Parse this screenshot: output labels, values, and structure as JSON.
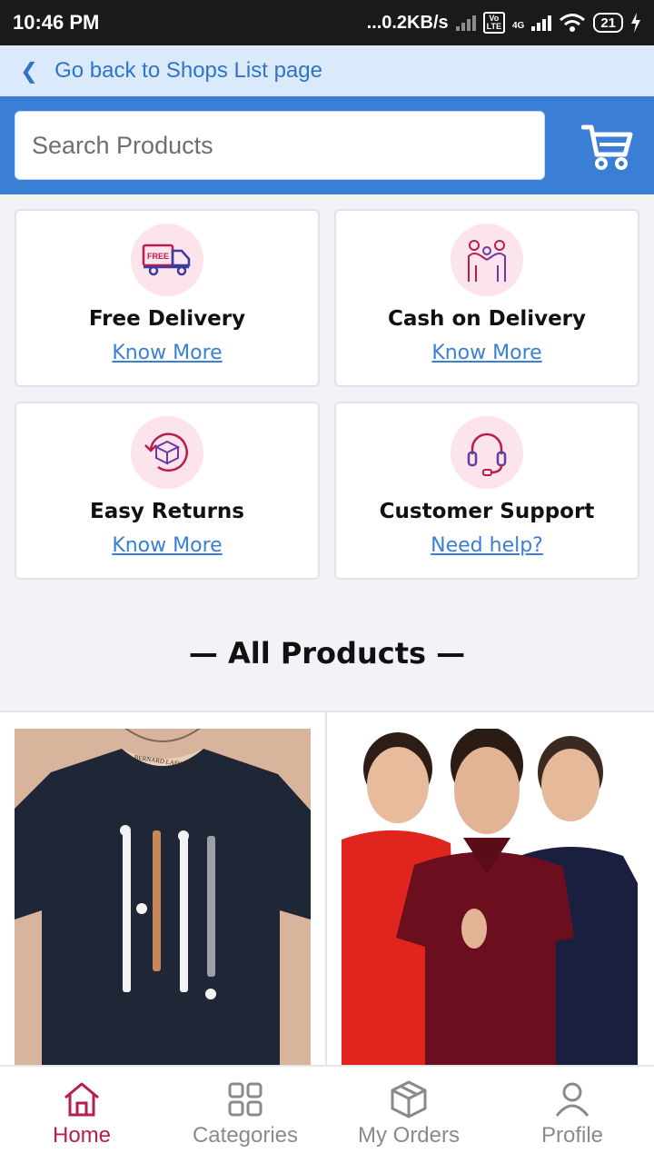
{
  "status_bar": {
    "time": "10:46 PM",
    "net_speed": "...0.2KB/s",
    "network": "4G",
    "battery": "21"
  },
  "back_link": {
    "label": "Go back to Shops List page"
  },
  "search": {
    "placeholder": "Search Products",
    "value": ""
  },
  "features": [
    {
      "title": "Free Delivery",
      "link": "Know More",
      "icon": "free-delivery-truck-icon",
      "icon_text": "FREE"
    },
    {
      "title": "Cash on Delivery",
      "link": "Know More",
      "icon": "cash-handover-icon"
    },
    {
      "title": "Easy Returns",
      "link": "Know More",
      "icon": "return-box-icon"
    },
    {
      "title": "Customer Support",
      "link": "Need help?",
      "icon": "headset-icon"
    }
  ],
  "section": {
    "title": "— All Products —"
  },
  "products": [
    {
      "image": "black-printed-tshirt",
      "label_text": "BERNARD LAFOND"
    },
    {
      "image": "polo-tshirts-models"
    }
  ],
  "bottom_nav": [
    {
      "label": "Home",
      "icon": "home-icon",
      "active": true
    },
    {
      "label": "Categories",
      "icon": "grid-icon",
      "active": false
    },
    {
      "label": "My Orders",
      "icon": "box-icon",
      "active": false
    },
    {
      "label": "Profile",
      "icon": "user-icon",
      "active": false
    }
  ],
  "colors": {
    "primary": "#3a7fd5",
    "accent": "#b81d4e",
    "back_bar": "#dbeafb"
  }
}
